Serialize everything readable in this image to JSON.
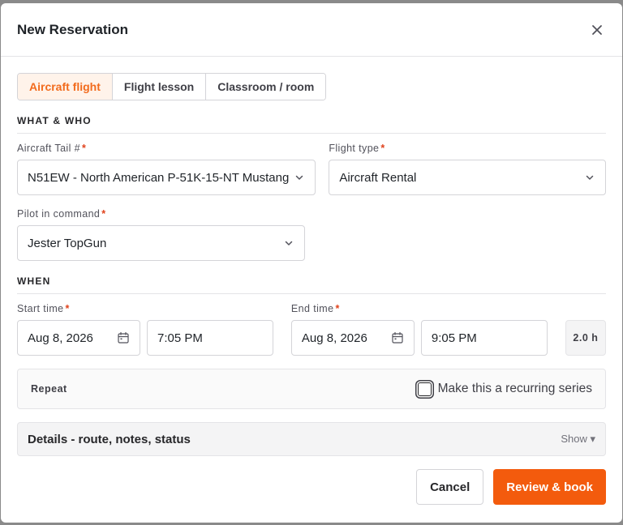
{
  "modal": {
    "title": "New Reservation"
  },
  "tabs": [
    {
      "label": "Aircraft flight",
      "active": true
    },
    {
      "label": "Flight lesson",
      "active": false
    },
    {
      "label": "Classroom / room",
      "active": false
    }
  ],
  "sections": {
    "what_who": "WHAT & WHO",
    "when": "WHEN"
  },
  "fields": {
    "aircraft": {
      "label": "Aircraft Tail #",
      "required": "*",
      "value": "N51EW - North American P-51K-15-NT Mustang"
    },
    "flight_type": {
      "label": "Flight type",
      "required": "*",
      "value": "Aircraft Rental"
    },
    "pilot": {
      "label": "Pilot in command",
      "required": "*",
      "value": "Jester TopGun"
    },
    "start": {
      "label": "Start time",
      "required": "*",
      "date": "Aug 8, 2026",
      "time": "7:05 PM"
    },
    "end": {
      "label": "End time",
      "required": "*",
      "date": "Aug 8, 2026",
      "time": "9:05 PM"
    },
    "duration": "2.0 h"
  },
  "repeat": {
    "label": "Repeat",
    "checkbox_label": "Make this a recurring series",
    "checked": false
  },
  "details": {
    "title": "Details - route, notes, status",
    "toggle": "Show ▾"
  },
  "buttons": {
    "cancel": "Cancel",
    "submit": "Review & book"
  },
  "colors": {
    "accent": "#f35b0d",
    "required": "#e0421c",
    "active_tab_bg": "#fff3ea"
  },
  "icons": {
    "close": "close-icon",
    "chevron": "chevron-down-icon",
    "calendar": "calendar-icon"
  }
}
